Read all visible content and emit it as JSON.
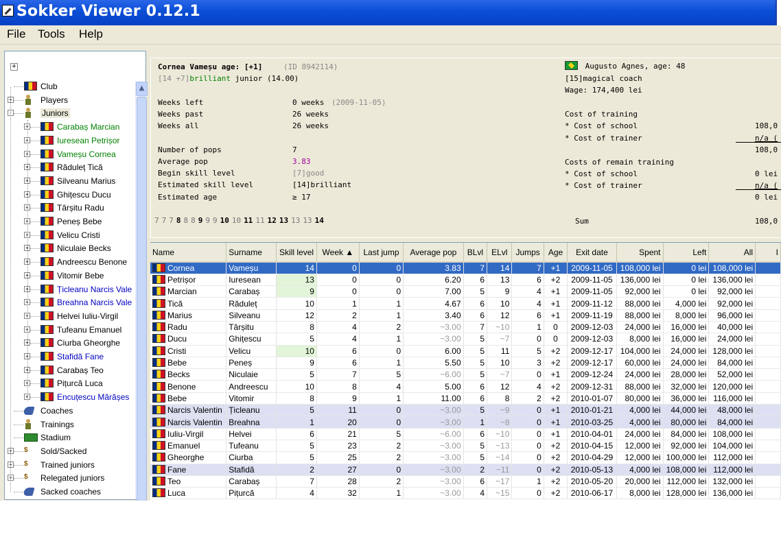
{
  "window": {
    "title": "Sokker Viewer 0.12.1"
  },
  "menu": [
    "File",
    "Tools",
    "Help"
  ],
  "tree": {
    "expand_all": "+",
    "nodes": [
      {
        "label": "Club",
        "icon": "flag-icon",
        "color": "#000000",
        "level": 0,
        "toggle": ""
      },
      {
        "label": "Players",
        "icon": "player-icon",
        "color": "#000000",
        "level": 0,
        "toggle": "+"
      },
      {
        "label": "Juniors",
        "icon": "player-icon",
        "color": "#000000",
        "level": 0,
        "toggle": "-"
      },
      {
        "label": "Carabaș Marcian",
        "icon": "flag-icon",
        "color": "#008000",
        "level": 1,
        "toggle": "+"
      },
      {
        "label": "Iuresean Petrișor",
        "icon": "flag-icon",
        "color": "#008000",
        "level": 1,
        "toggle": "+"
      },
      {
        "label": "Vameșu Cornea",
        "icon": "flag-icon",
        "color": "#008000",
        "level": 1,
        "toggle": "+"
      },
      {
        "label": "Răduleț Tică",
        "icon": "flag-icon",
        "color": "#000000",
        "level": 1,
        "toggle": "+"
      },
      {
        "label": "Silveanu Marius",
        "icon": "flag-icon",
        "color": "#000000",
        "level": 1,
        "toggle": "+"
      },
      {
        "label": "Ghițescu Ducu",
        "icon": "flag-icon",
        "color": "#000000",
        "level": 1,
        "toggle": "+"
      },
      {
        "label": "Târșitu Radu",
        "icon": "flag-icon",
        "color": "#000000",
        "level": 1,
        "toggle": "+"
      },
      {
        "label": "Peneș Bebe",
        "icon": "flag-icon",
        "color": "#000000",
        "level": 1,
        "toggle": "+"
      },
      {
        "label": "Velicu Cristi",
        "icon": "flag-icon",
        "color": "#000000",
        "level": 1,
        "toggle": "+"
      },
      {
        "label": "Niculaie Becks",
        "icon": "flag-icon",
        "color": "#000000",
        "level": 1,
        "toggle": "+"
      },
      {
        "label": "Andreescu Benone",
        "icon": "flag-icon",
        "color": "#000000",
        "level": 1,
        "toggle": "+"
      },
      {
        "label": "Vitomir Bebe",
        "icon": "flag-icon",
        "color": "#000000",
        "level": 1,
        "toggle": "+"
      },
      {
        "label": "Țicleanu Narcis Vale",
        "icon": "flag-icon",
        "color": "#0000c0",
        "level": 1,
        "toggle": "+"
      },
      {
        "label": "Breahna Narcis Vale",
        "icon": "flag-icon",
        "color": "#0000c0",
        "level": 1,
        "toggle": "+"
      },
      {
        "label": "Helvei Iuliu-Virgil",
        "icon": "flag-icon",
        "color": "#000000",
        "level": 1,
        "toggle": "+"
      },
      {
        "label": "Tufeanu Emanuel",
        "icon": "flag-icon",
        "color": "#000000",
        "level": 1,
        "toggle": "+"
      },
      {
        "label": "Ciurba Gheorghe",
        "icon": "flag-icon",
        "color": "#000000",
        "level": 1,
        "toggle": "+"
      },
      {
        "label": "Stafidă Fane",
        "icon": "flag-icon",
        "color": "#0000c0",
        "level": 1,
        "toggle": "+"
      },
      {
        "label": "Carabaș Teo",
        "icon": "flag-icon",
        "color": "#000000",
        "level": 1,
        "toggle": "+"
      },
      {
        "label": "Pițurcă Luca",
        "icon": "flag-icon",
        "color": "#000000",
        "level": 1,
        "toggle": "+"
      },
      {
        "label": "Encuțescu Mărășes",
        "icon": "flag-icon",
        "color": "#0000c0",
        "level": 1,
        "toggle": "+"
      },
      {
        "label": "Coaches",
        "icon": "shoe-icon",
        "color": "#000000",
        "level": 0,
        "toggle": ""
      },
      {
        "label": "Trainings",
        "icon": "player-icon",
        "color": "#000000",
        "level": 0,
        "toggle": ""
      },
      {
        "label": "Stadium",
        "icon": "stadium-icon",
        "color": "#000000",
        "level": 0,
        "toggle": ""
      },
      {
        "label": "Sold/Sacked",
        "icon": "money-icon",
        "color": "#000000",
        "level": 0,
        "toggle": "+"
      },
      {
        "label": "Trained juniors",
        "icon": "money-icon",
        "color": "#000000",
        "level": 0,
        "toggle": "+"
      },
      {
        "label": "Relegated juniors",
        "icon": "money-icon",
        "color": "#000000",
        "level": 0,
        "toggle": "+"
      },
      {
        "label": "Sacked coaches",
        "icon": "shoe-icon",
        "color": "#000000",
        "level": 0,
        "toggle": ""
      }
    ]
  },
  "junior": {
    "name_age": "Cornea Vameșu age: [+1]",
    "id": "(ID 8942114)",
    "skill_prefix": "[14 +7]",
    "skill_word": "brilliant",
    "skill_suffix": "junior (14.00)",
    "weeks_left_label": "Weeks left",
    "weeks_left_value": "0 weeks",
    "weeks_left_date": "(2009-11-05)",
    "weeks_past_label": "Weeks past",
    "weeks_past_value": "26 weeks",
    "weeks_all_label": "Weeks all",
    "weeks_all_value": "26 weeks",
    "pops_label": "Number of pops",
    "pops_value": "7",
    "avg_pop_label": "Average pop",
    "avg_pop_value": "3.83",
    "begin_label": "Begin skill level",
    "begin_prefix": "[7]",
    "begin_word": "good",
    "est_skill_label": "Estimated skill level",
    "est_skill_value": "[14]brilliant",
    "est_age_label": "Estimated age",
    "est_age_value": "≥ 17",
    "skill_sequence": [
      "7",
      "7",
      "7",
      "8",
      "8",
      "8",
      "9",
      "9",
      "9",
      "10",
      "10",
      "11",
      "11",
      "12",
      "13",
      "13",
      "13",
      "14"
    ]
  },
  "coach": {
    "name_age": "Augusto Agnes, age: 48",
    "level": "[15]magical coach",
    "wage": "Wage: 174,400 lei",
    "cost_training_label": "Cost of training",
    "cost_school_label": "* Cost of school",
    "cost_school_value": "108,0",
    "cost_trainer_label": "* Cost of trainer",
    "cost_trainer_value": "n/a (",
    "cost_training_total": "108,0",
    "remain_label": "Costs of remain training",
    "remain_school_label": "* Cost of school",
    "remain_school_value": "0 lei",
    "remain_trainer_label": "* Cost of trainer",
    "remain_trainer_value": "n/a (",
    "remain_total": "0 lei",
    "sum_label": "Sum",
    "sum_value": "108,0"
  },
  "table": {
    "columns": [
      "Name",
      "Surname",
      "Skill level",
      "Week ▲",
      "Last jump",
      "Average pop",
      "BLvl",
      "ELvl",
      "Jumps",
      "Age",
      "Exit date",
      "Spent",
      "Left",
      "All",
      "I"
    ],
    "rows": [
      [
        "Cornea",
        "Vameșu",
        "14",
        "0",
        "0",
        "3.83",
        "7",
        "14",
        "7",
        "+1",
        "2009-11-05",
        "108,000 lei",
        "0 lei",
        "108,000 lei"
      ],
      [
        "Petrișor",
        "Iuresean",
        "13",
        "0",
        "0",
        "6.20",
        "6",
        "13",
        "6",
        "+2",
        "2009-11-05",
        "136,000 lei",
        "0 lei",
        "136,000 lei"
      ],
      [
        "Marcian",
        "Carabaș",
        "9",
        "0",
        "0",
        "7.00",
        "5",
        "9",
        "4",
        "+1",
        "2009-11-05",
        "92,000 lei",
        "0 lei",
        "92,000 lei"
      ],
      [
        "Tică",
        "Răduleț",
        "10",
        "1",
        "1",
        "4.67",
        "6",
        "10",
        "4",
        "+1",
        "2009-11-12",
        "88,000 lei",
        "4,000 lei",
        "92,000 lei"
      ],
      [
        "Marius",
        "Silveanu",
        "12",
        "2",
        "1",
        "3.40",
        "6",
        "12",
        "6",
        "+1",
        "2009-11-19",
        "88,000 lei",
        "8,000 lei",
        "96,000 lei"
      ],
      [
        "Radu",
        "Târșitu",
        "8",
        "4",
        "2",
        "~3.00",
        "7",
        "~10",
        "1",
        "0",
        "2009-12-03",
        "24,000 lei",
        "16,000 lei",
        "40,000 lei"
      ],
      [
        "Ducu",
        "Ghițescu",
        "5",
        "4",
        "1",
        "~3.00",
        "5",
        "~7",
        "0",
        "0",
        "2009-12-03",
        "8,000 lei",
        "16,000 lei",
        "24,000 lei"
      ],
      [
        "Cristi",
        "Velicu",
        "10",
        "6",
        "0",
        "6.00",
        "5",
        "11",
        "5",
        "+2",
        "2009-12-17",
        "104,000 lei",
        "24,000 lei",
        "128,000 lei"
      ],
      [
        "Bebe",
        "Peneș",
        "9",
        "6",
        "1",
        "5.50",
        "5",
        "10",
        "3",
        "+2",
        "2009-12-17",
        "60,000 lei",
        "24,000 lei",
        "84,000 lei"
      ],
      [
        "Becks",
        "Niculaie",
        "5",
        "7",
        "5",
        "~6.00",
        "5",
        "~7",
        "0",
        "+1",
        "2009-12-24",
        "24,000 lei",
        "28,000 lei",
        "52,000 lei"
      ],
      [
        "Benone",
        "Andreescu",
        "10",
        "8",
        "4",
        "5.00",
        "6",
        "12",
        "4",
        "+2",
        "2009-12-31",
        "88,000 lei",
        "32,000 lei",
        "120,000 lei"
      ],
      [
        "Bebe",
        "Vitomir",
        "8",
        "9",
        "1",
        "11.00",
        "6",
        "8",
        "2",
        "+2",
        "2010-01-07",
        "80,000 lei",
        "36,000 lei",
        "116,000 lei"
      ],
      [
        "Narcis Valentin",
        "Țicleanu",
        "5",
        "11",
        "0",
        "~3.00",
        "5",
        "~9",
        "0",
        "+1",
        "2010-01-21",
        "4,000 lei",
        "44,000 lei",
        "48,000 lei"
      ],
      [
        "Narcis Valentin",
        "Breahna",
        "1",
        "20",
        "0",
        "~3.00",
        "1",
        "~8",
        "0",
        "+1",
        "2010-03-25",
        "4,000 lei",
        "80,000 lei",
        "84,000 lei"
      ],
      [
        "Iuliu-Virgil",
        "Helvei",
        "6",
        "21",
        "5",
        "~6.00",
        "6",
        "~10",
        "0",
        "+1",
        "2010-04-01",
        "24,000 lei",
        "84,000 lei",
        "108,000 lei"
      ],
      [
        "Emanuel",
        "Tufeanu",
        "5",
        "23",
        "2",
        "~3.00",
        "5",
        "~13",
        "0",
        "+2",
        "2010-04-15",
        "12,000 lei",
        "92,000 lei",
        "104,000 lei"
      ],
      [
        "Gheorghe",
        "Ciurba",
        "5",
        "25",
        "2",
        "~3.00",
        "5",
        "~14",
        "0",
        "+2",
        "2010-04-29",
        "12,000 lei",
        "100,000 lei",
        "112,000 lei"
      ],
      [
        "Fane",
        "Stafidă",
        "2",
        "27",
        "0",
        "~3.00",
        "2",
        "~11",
        "0",
        "+2",
        "2010-05-13",
        "4,000 lei",
        "108,000 lei",
        "112,000 lei"
      ],
      [
        "Teo",
        "Carabaș",
        "7",
        "28",
        "2",
        "~3.00",
        "6",
        "~17",
        "1",
        "+2",
        "2010-05-20",
        "20,000 lei",
        "112,000 lei",
        "132,000 lei"
      ],
      [
        "Luca",
        "Pițurcă",
        "4",
        "32",
        "1",
        "~3.00",
        "4",
        "~15",
        "0",
        "+2",
        "2010-06-17",
        "8,000 lei",
        "128,000 lei",
        "136,000 lei"
      ]
    ]
  }
}
